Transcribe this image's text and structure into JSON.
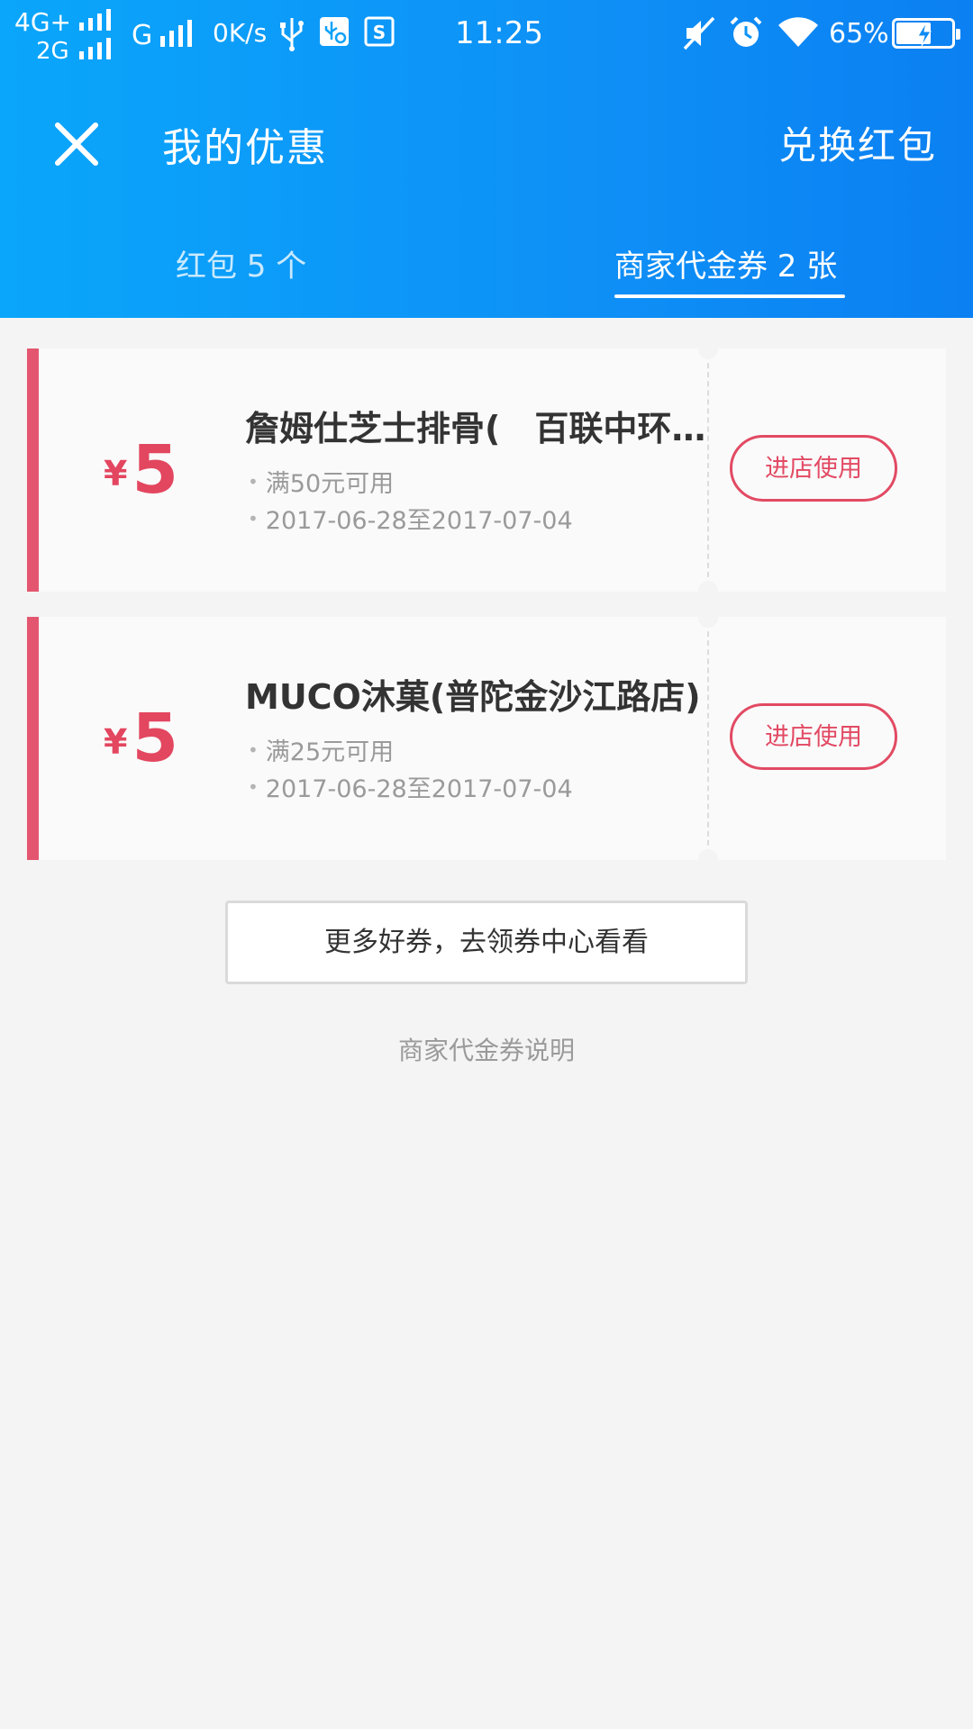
{
  "status_bar": {
    "network_1": "4G+",
    "network_2": "2G",
    "network_3": "G",
    "speed": "0K/s",
    "time": "11:25",
    "battery": "65%"
  },
  "app_bar": {
    "title": "我的优惠",
    "right_action": "兑换红包"
  },
  "tabs": [
    {
      "label": "红包 5 个",
      "active": false
    },
    {
      "label": "商家代金券 2 张",
      "active": true
    }
  ],
  "coupons": [
    {
      "currency": "¥",
      "amount": "5",
      "name": "詹姆仕芝士排骨(　百联中环店)",
      "condition": "满50元可用",
      "period": "2017-06-28至2017-07-04",
      "action": "进店使用"
    },
    {
      "currency": "¥",
      "amount": "5",
      "name": "MUCO沐菓(普陀金沙江路店)",
      "condition": "满25元可用",
      "period": "2017-06-28至2017-07-04",
      "action": "进店使用"
    }
  ],
  "more_button": "更多好券，去领券中心看看",
  "explain_link": "商家代金券说明",
  "colors": {
    "header_start": "#0aa6fb",
    "header_end": "#0b80f2",
    "accent_red": "#e3465f",
    "page_bg": "#f4f4f4"
  },
  "icons": [
    "usb-icon",
    "usb-settings-icon",
    "sim-icon",
    "mute-icon",
    "alarm-icon",
    "wifi-icon",
    "battery-icon",
    "close-icon"
  ]
}
